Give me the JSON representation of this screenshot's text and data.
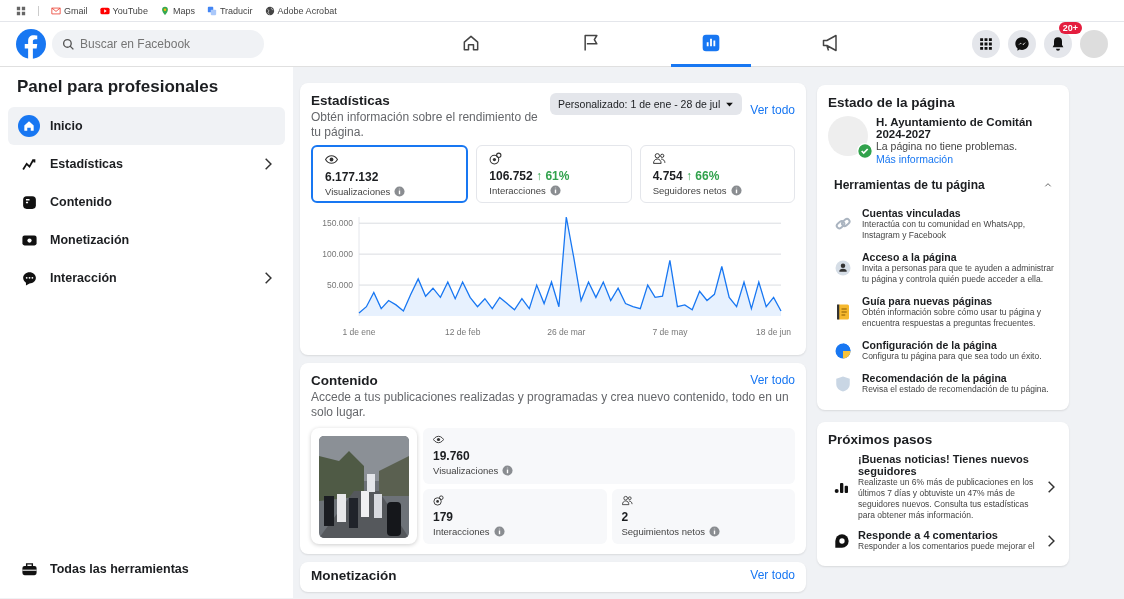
{
  "bookmarks": [
    {
      "kind": "mail",
      "label": "Gmail"
    },
    {
      "kind": "video",
      "label": "YouTube"
    },
    {
      "kind": "pin",
      "label": "Maps"
    },
    {
      "kind": "translate",
      "label": "Traducir"
    },
    {
      "kind": "globe",
      "label": "Adobe Acrobat"
    }
  ],
  "search": {
    "placeholder": "Buscar en Facebook"
  },
  "nav_tabs": [
    {
      "kind": "home",
      "selected": false
    },
    {
      "kind": "flag",
      "selected": false
    },
    {
      "kind": "chart",
      "selected": true
    },
    {
      "kind": "megaphone",
      "selected": false
    }
  ],
  "notifications_badge": "20+",
  "sidebar": {
    "title": "Panel para profesionales",
    "items": [
      {
        "kind": "home",
        "label": "Inicio",
        "selected": true,
        "expandable": false
      },
      {
        "kind": "stats",
        "label": "Estadísticas",
        "selected": false,
        "expandable": true
      },
      {
        "kind": "content",
        "label": "Contenido",
        "selected": false,
        "expandable": false
      },
      {
        "kind": "money",
        "label": "Monetización",
        "selected": false,
        "expandable": false
      },
      {
        "kind": "chat",
        "label": "Interacción",
        "selected": false,
        "expandable": true
      }
    ],
    "footer": {
      "kind": "toolbox",
      "label": "Todas las herramientas"
    }
  },
  "statistics": {
    "title": "Estadísticas",
    "description": "Obtén información sobre el rendimiento de tu página.",
    "date_filter": "Personalizado: 1 de ene - 28 de jul",
    "link": "Ver todo",
    "metrics": [
      {
        "kind": "eye",
        "value": "6.177.132",
        "label": "Visualizaciones",
        "selected": true
      },
      {
        "kind": "interactions",
        "value": "106.752",
        "change": "↑ 61%",
        "label": "Interacciones",
        "selected": false
      },
      {
        "kind": "people",
        "value": "4.754",
        "change": "↑ 66%",
        "label": "Seguidores netos",
        "selected": false
      }
    ],
    "chart_data": {
      "type": "area",
      "categories": [
        "1 de ene",
        null,
        null,
        null,
        null,
        null,
        null,
        null,
        null,
        null,
        null,
        null,
        null,
        null,
        "12 de feb",
        null,
        null,
        null,
        null,
        null,
        null,
        null,
        null,
        null,
        null,
        null,
        null,
        null,
        "26 de mar",
        null,
        null,
        null,
        null,
        null,
        null,
        null,
        null,
        null,
        null,
        null,
        null,
        null,
        "7 de may",
        null,
        null,
        null,
        null,
        null,
        null,
        null,
        null,
        null,
        null,
        null,
        null,
        null,
        "18 de jun",
        null
      ],
      "series": [
        {
          "color": "#1877f2",
          "values": [
            5000,
            15000,
            38000,
            12000,
            25000,
            18000,
            8000,
            35000,
            60000,
            32000,
            45000,
            30000,
            55000,
            28000,
            55000,
            30000,
            15000,
            28000,
            12000,
            30000,
            20000,
            10000,
            28000,
            12000,
            50000,
            20000,
            55000,
            15000,
            160000,
            95000,
            25000,
            55000,
            30000,
            55000,
            25000,
            45000,
            20000,
            15000,
            12000,
            50000,
            30000,
            32000,
            90000,
            15000,
            18000,
            10000,
            40000,
            25000,
            35000,
            80000,
            30000,
            15000,
            55000,
            12000,
            55000,
            15000,
            30000,
            8000
          ]
        }
      ],
      "grid": true,
      "ylim": [
        0,
        160000
      ],
      "yticks": [
        {
          "value": 50000,
          "label": "50.000"
        },
        {
          "value": 100000,
          "label": "100.000"
        },
        {
          "value": 150000,
          "label": "150.000"
        }
      ]
    }
  },
  "content": {
    "title": "Contenido",
    "link": "Ver todo",
    "description": "Accede a tus publicaciones realizadas y programadas y crea nuevo contenido, todo en un solo lugar.",
    "post": {
      "metrics": [
        {
          "kind": "eye",
          "value": "19.760",
          "label": "Visualizaciones"
        },
        {
          "kind": "interactions",
          "value": "179",
          "label": "Interacciones"
        },
        {
          "kind": "people",
          "value": "2",
          "label": "Seguimientos netos"
        }
      ]
    }
  },
  "monetization": {
    "title": "Monetización",
    "link": "Ver todo"
  },
  "page_status": {
    "title": "Estado de la página",
    "page_name": "H. Ayuntamiento de Comitán 2024-2027",
    "status_text": "La página no tiene problemas.",
    "status_link": "Más información",
    "tools_title": "Herramientas de tu página",
    "tools_expanded": true,
    "tools": [
      {
        "kind": "link",
        "title": "Cuentas vinculadas",
        "description": "Interactúa con tu comunidad en WhatsApp, Instagram y Facebook"
      },
      {
        "kind": "person",
        "title": "Acceso a la página",
        "description": "Invita a personas para que te ayuden a administrar tu página y controla quién puede acceder a ella."
      },
      {
        "kind": "book",
        "title": "Guía para nuevas páginas",
        "description": "Obtén información sobre cómo usar tu página y encuentra respuestas a preguntas frecuentes."
      },
      {
        "kind": "pie",
        "title": "Configuración de la página",
        "description": "Configura tu página para que sea todo un éxito."
      },
      {
        "kind": "shield",
        "title": "Recomendación de la página",
        "description": "Revisa el estado de recomendación de tu página."
      }
    ]
  },
  "next_steps": {
    "title": "Próximos pasos",
    "items": [
      {
        "kind": "bars",
        "title": "¡Buenas noticias! Tienes nuevos seguidores",
        "description": "Realizaste un 6% más de publicaciones en los últimos 7 días y obtuviste un 47% más de seguidores nuevos. Consulta tus estadísticas para obtener más información."
      },
      {
        "kind": "comment",
        "title": "Responde a 4 comentarios",
        "description": "Responder a los comentarios puede mejorar el"
      }
    ]
  }
}
